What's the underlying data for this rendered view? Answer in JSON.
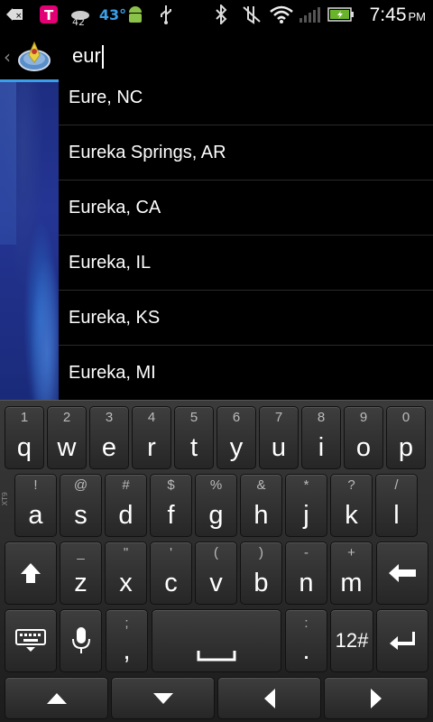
{
  "status_bar": {
    "icons": [
      "back-icon",
      "tmobile-icon",
      "weather-icon",
      "temperature-icon",
      "android-icon",
      "usb-icon",
      "bluetooth-icon",
      "mute-icon",
      "wifi-icon",
      "signal-icon",
      "battery-icon"
    ],
    "weather_temp": "42",
    "temperature": "43°",
    "time": "7:45",
    "ampm": "PM"
  },
  "search": {
    "query": "eur"
  },
  "suggestions": [
    "Eure, NC",
    "Eureka Springs, AR",
    "Eureka, CA",
    "Eureka, IL",
    "Eureka, KS",
    "Eureka, MI"
  ],
  "keyboard": {
    "side_label": "XT9",
    "row1": [
      {
        "sec": "1",
        "pri": "q"
      },
      {
        "sec": "2",
        "pri": "w"
      },
      {
        "sec": "3",
        "pri": "e"
      },
      {
        "sec": "4",
        "pri": "r"
      },
      {
        "sec": "5",
        "pri": "t"
      },
      {
        "sec": "6",
        "pri": "y"
      },
      {
        "sec": "7",
        "pri": "u"
      },
      {
        "sec": "8",
        "pri": "i"
      },
      {
        "sec": "9",
        "pri": "o"
      },
      {
        "sec": "0",
        "pri": "p"
      }
    ],
    "row2": [
      {
        "sec": "!",
        "pri": "a"
      },
      {
        "sec": "@",
        "pri": "s"
      },
      {
        "sec": "#",
        "pri": "d"
      },
      {
        "sec": "$",
        "pri": "f"
      },
      {
        "sec": "%",
        "pri": "g"
      },
      {
        "sec": "&",
        "pri": "h"
      },
      {
        "sec": "*",
        "pri": "j"
      },
      {
        "sec": "?",
        "pri": "k"
      },
      {
        "sec": "/",
        "pri": "l"
      }
    ],
    "row3": [
      {
        "sec": "_",
        "pri": "z"
      },
      {
        "sec": "\"",
        "pri": "x"
      },
      {
        "sec": "'",
        "pri": "c"
      },
      {
        "sec": "(",
        "pri": "v"
      },
      {
        "sec": ")",
        "pri": "b"
      },
      {
        "sec": "-",
        "pri": "n"
      },
      {
        "sec": "+",
        "pri": "m"
      }
    ],
    "comma_sec": ";",
    "comma_pri": ",",
    "period_sec": ":",
    "period_pri": ".",
    "symbols_label": "12#"
  }
}
